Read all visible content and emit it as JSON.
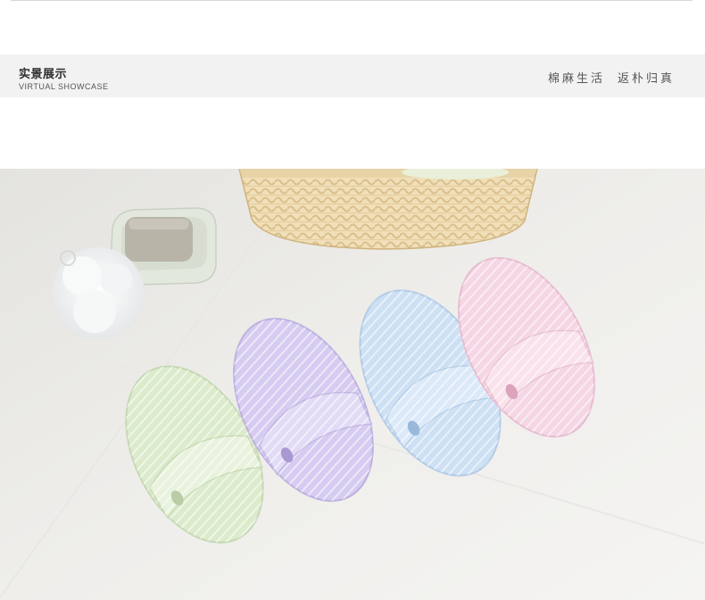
{
  "header": {
    "title": "实景展示",
    "subtitle": "VIRTUAL SHOWCASE",
    "slogan_part1": "棉麻生活",
    "slogan_part2": "返朴归真"
  },
  "showcase": {
    "slipper_colors": [
      "#dfeecd",
      "#d8cdf1",
      "#cfe1f5",
      "#f6d9e7"
    ],
    "background": "#ecebe8"
  }
}
